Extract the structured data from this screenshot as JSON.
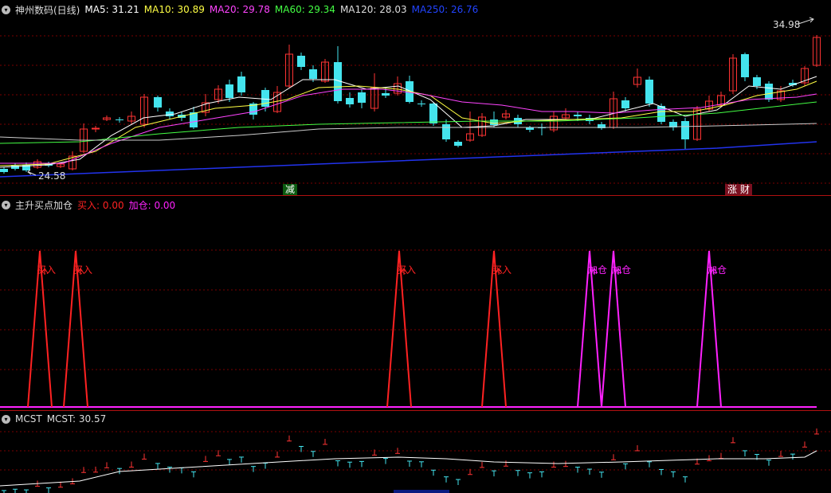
{
  "main_panel": {
    "title": "神州数码(日线)",
    "ma_items": [
      {
        "label": "MA5: 31.21",
        "color": "#ffffff"
      },
      {
        "label": "MA10: 30.89",
        "color": "#ffff44"
      },
      {
        "label": "MA20: 29.78",
        "color": "#ff44ff"
      },
      {
        "label": "MA60: 29.34",
        "color": "#44ff44"
      },
      {
        "label": "MA120: 28.03",
        "color": "#dddddd"
      },
      {
        "label": "MA250: 26.76",
        "color": "#2244ff"
      }
    ],
    "high_label": "34.98",
    "low_label": "24.58",
    "tag_left": "减",
    "tag_right": "涨 财",
    "colors": {
      "up": "#ff3333",
      "down": "#44e4ee",
      "grid": "#8a0000"
    }
  },
  "signal_panel": {
    "title": "主升买点加仓",
    "buy_label": "买入: 0.00",
    "add_label": "加仓: 0.00",
    "buy_color": "#ff2222",
    "add_color": "#ff22ff",
    "signals": [
      {
        "type": "buy",
        "text": "买入"
      },
      {
        "type": "buy",
        "text": "买入"
      },
      {
        "type": "buy",
        "text": "买入"
      },
      {
        "type": "buy",
        "text": "买入"
      },
      {
        "type": "add",
        "text": "加仓"
      },
      {
        "type": "add",
        "text": "加仓"
      },
      {
        "type": "add",
        "text": "加仓"
      }
    ]
  },
  "mcst_panel": {
    "title": "MCST",
    "value_label": "MCST: 30.57"
  }
}
